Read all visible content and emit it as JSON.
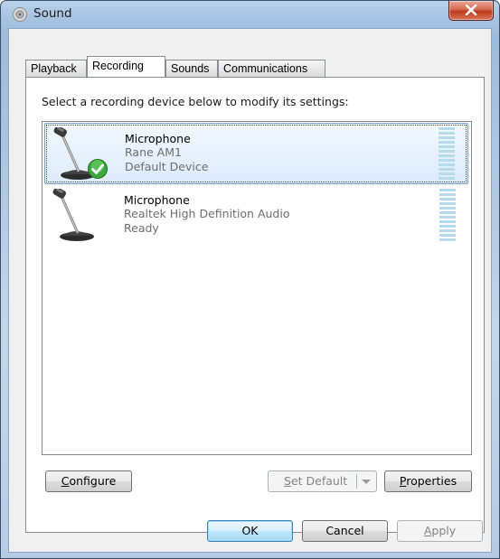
{
  "window": {
    "title": "Sound",
    "title_icon": "speaker-icon",
    "close_icon": "close-icon"
  },
  "tabs": [
    {
      "label": "Playback",
      "active": false
    },
    {
      "label": "Recording",
      "active": true
    },
    {
      "label": "Sounds",
      "active": false
    },
    {
      "label": "Communications",
      "active": false
    }
  ],
  "instruction": "Select a recording device below to modify its settings:",
  "devices": [
    {
      "name": "Microphone",
      "driver": "Rane AM1",
      "status": "Default Device",
      "selected": true,
      "icon": "microphone-icon",
      "badge": "default-check-icon"
    },
    {
      "name": "Microphone",
      "driver": "Realtek High Definition Audio",
      "status": "Ready",
      "selected": false,
      "icon": "microphone-icon"
    }
  ],
  "buttons": {
    "configure": {
      "mnemonic": "C",
      "rest": "onfigure"
    },
    "set_default": {
      "mnemonic": "S",
      "rest": "et Default"
    },
    "properties": {
      "mnemonic": "P",
      "rest": "roperties"
    },
    "ok": "OK",
    "cancel": "Cancel",
    "apply": {
      "mnemonic": "A",
      "rest": "pply"
    }
  },
  "colors": {
    "selection": "#dcebfc",
    "meter": "#b6dceb",
    "close": "#c0391d",
    "check": "#3aa83a"
  }
}
